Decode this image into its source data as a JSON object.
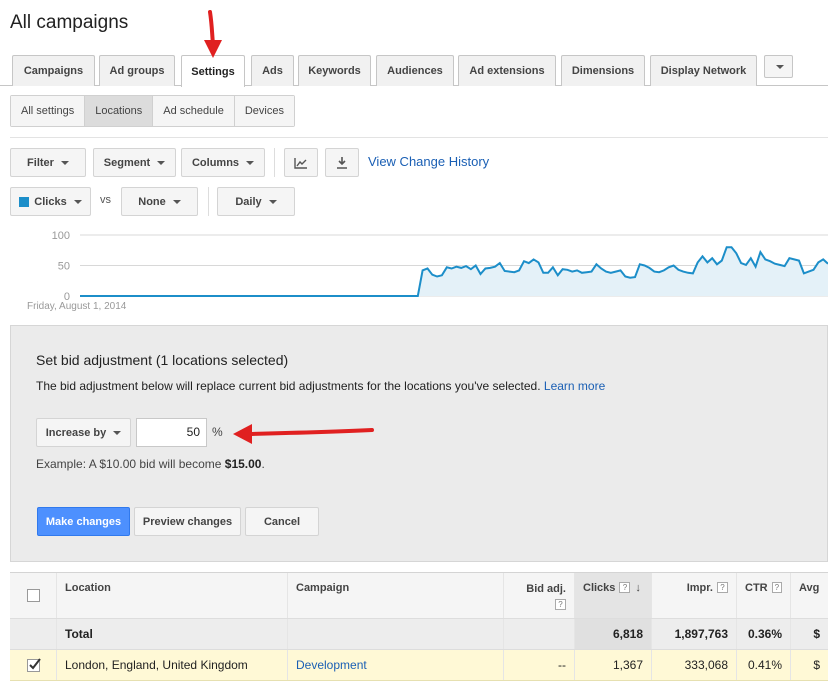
{
  "page": {
    "title": "All campaigns"
  },
  "tabs": [
    {
      "label": "Campaigns"
    },
    {
      "label": "Ad groups"
    },
    {
      "label": "Settings"
    },
    {
      "label": "Ads"
    },
    {
      "label": "Keywords"
    },
    {
      "label": "Audiences"
    },
    {
      "label": "Ad extensions"
    },
    {
      "label": "Dimensions"
    },
    {
      "label": "Display Network"
    }
  ],
  "active_tab": "Settings",
  "subtabs": [
    {
      "label": "All settings"
    },
    {
      "label": "Locations"
    },
    {
      "label": "Ad schedule"
    },
    {
      "label": "Devices"
    }
  ],
  "active_subtab": "Locations",
  "toolbar": {
    "filter": "Filter",
    "segment": "Segment",
    "columns": "Columns",
    "view_history": "View Change History"
  },
  "chart_controls": {
    "metric1": "Clicks",
    "vs": "vs",
    "metric2": "None",
    "period": "Daily",
    "metric1_color": "#1c8ec9"
  },
  "chart_data": {
    "type": "area",
    "ylabel": "",
    "yticks": [
      "100",
      "50",
      "0"
    ],
    "ylim": [
      0,
      100
    ],
    "start_label": "Friday, August 1, 2014",
    "color": "#1c8ec9",
    "values": [
      0,
      0,
      0,
      0,
      0,
      0,
      0,
      0,
      0,
      0,
      0,
      0,
      0,
      0,
      0,
      0,
      0,
      0,
      0,
      0,
      0,
      0,
      0,
      0,
      0,
      0,
      0,
      0,
      0,
      0,
      0,
      0,
      0,
      0,
      0,
      0,
      0,
      0,
      0,
      0,
      0,
      0,
      0,
      0,
      0,
      0,
      0,
      0,
      0,
      0,
      0,
      0,
      0,
      0,
      0,
      0,
      0,
      0,
      0,
      0,
      0,
      0,
      0,
      0,
      0,
      0,
      0,
      0,
      0,
      0,
      0,
      42,
      45,
      35,
      32,
      34,
      47,
      45,
      48,
      46,
      49,
      44,
      50,
      36,
      45,
      46,
      48,
      54,
      41,
      40,
      39,
      42,
      57,
      54,
      60,
      55,
      38,
      38,
      47,
      34,
      44,
      43,
      40,
      42,
      38,
      39,
      40,
      52,
      45,
      40,
      38,
      40,
      42,
      32,
      30,
      31,
      52,
      50,
      46,
      40,
      39,
      42,
      47,
      50,
      43,
      40,
      38,
      37,
      55,
      65,
      55,
      62,
      52,
      58,
      80,
      80,
      70,
      54,
      51,
      62,
      48,
      72,
      60,
      57,
      53,
      51,
      49,
      62,
      60,
      58,
      37,
      40,
      43,
      55,
      60,
      53
    ]
  },
  "bid_panel": {
    "title": "Set bid adjustment (1 locations selected)",
    "description": "The bid adjustment below will replace current bid adjustments for the locations you've selected.",
    "learn_more": "Learn more",
    "mode": "Increase by",
    "value": "50",
    "unit": "%",
    "example_prefix": "Example: A $10.00 bid will become ",
    "example_value": "$15.00",
    "example_suffix": ".",
    "make_changes": "Make changes",
    "preview_changes": "Preview changes",
    "cancel": "Cancel"
  },
  "table": {
    "headers": {
      "location": "Location",
      "campaign": "Campaign",
      "bid_adj": "Bid adj.",
      "clicks": "Clicks",
      "impr": "Impr.",
      "ctr": "CTR",
      "avg": "Avg"
    },
    "help_glyph": "?",
    "sort_glyph": "↓",
    "total": {
      "label": "Total",
      "clicks": "6,818",
      "impr": "1,897,763",
      "ctr": "0.36%",
      "avg": "$"
    },
    "rows": [
      {
        "location": "London, England, United Kingdom",
        "campaign": "Development",
        "bid_adj": "--",
        "clicks": "1,367",
        "impr": "333,068",
        "ctr": "0.41%",
        "avg": "$",
        "checked": true
      }
    ]
  }
}
